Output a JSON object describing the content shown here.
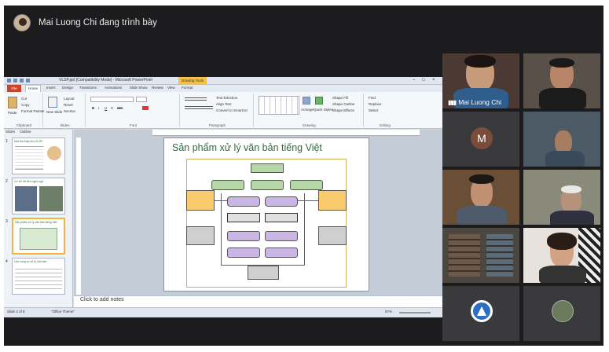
{
  "meeting": {
    "presenter_text": "Mai Luong Chi đang trình bày"
  },
  "ppt": {
    "window_title": "VLSP.ppt [Compatibility Mode] - Microsoft PowerPoint",
    "context_tab": "Drawing Tools",
    "window_controls": [
      "–",
      "□",
      "×"
    ],
    "tabs": [
      "File",
      "Home",
      "Insert",
      "Design",
      "Transitions",
      "Animations",
      "Slide Show",
      "Review",
      "View",
      "Format"
    ],
    "active_tab": "Home",
    "groups": {
      "clipboard": {
        "label": "Clipboard",
        "paste": "Paste",
        "cut": "Cut",
        "copy": "Copy",
        "format_painter": "Format Painter"
      },
      "slides": {
        "label": "Slides",
        "new_slide": "New Slide",
        "layout": "Layout",
        "reset": "Reset",
        "section": "Section"
      },
      "font": {
        "label": "Font",
        "bold": "B",
        "italic": "I",
        "underline": "U",
        "strike": "S",
        "shadow": "abc"
      },
      "paragraph": {
        "label": "Paragraph",
        "text_direction": "Text Direction",
        "align_text": "Align Text",
        "convert_smartart": "Convert to SmartArt"
      },
      "drawing": {
        "label": "Drawing",
        "arrange": "Arrange",
        "quick_styles": "Quick Styles",
        "shape_fill": "Shape Fill",
        "shape_outline": "Shape Outline",
        "shape_effects": "Shape Effects"
      },
      "editing": {
        "label": "Editing",
        "find": "Find",
        "replace": "Replace",
        "select": "Select"
      }
    },
    "panel_tabs": [
      "Slides",
      "Outline"
    ],
    "thumbnails": [
      {
        "num": "1",
        "title": "Một thu thập kho VLSP"
      },
      {
        "num": "2",
        "title": "Cơ sở dữ liệu ngôn ngữ"
      },
      {
        "num": "3",
        "title": "Sản phẩm xử lý văn bản tiếng Việt"
      },
      {
        "num": "4",
        "title": "Các công cụ xử lý văn bản"
      }
    ],
    "slide_title": "Sản phẩm xử lý văn bản tiếng Việt",
    "notes_placeholder": "Click to add notes",
    "status_left": "Slide 3 of 8",
    "status_theme": "\"Office Theme\"",
    "zoom": "57%"
  },
  "participants": [
    {
      "name": "Mai Luong Chi",
      "type": "video"
    },
    {
      "type": "video"
    },
    {
      "initial": "M",
      "type": "avatar"
    },
    {
      "type": "video"
    },
    {
      "type": "video"
    },
    {
      "type": "video"
    },
    {
      "type": "video"
    },
    {
      "type": "video"
    },
    {
      "type": "icon"
    },
    {
      "type": "icon"
    }
  ]
}
